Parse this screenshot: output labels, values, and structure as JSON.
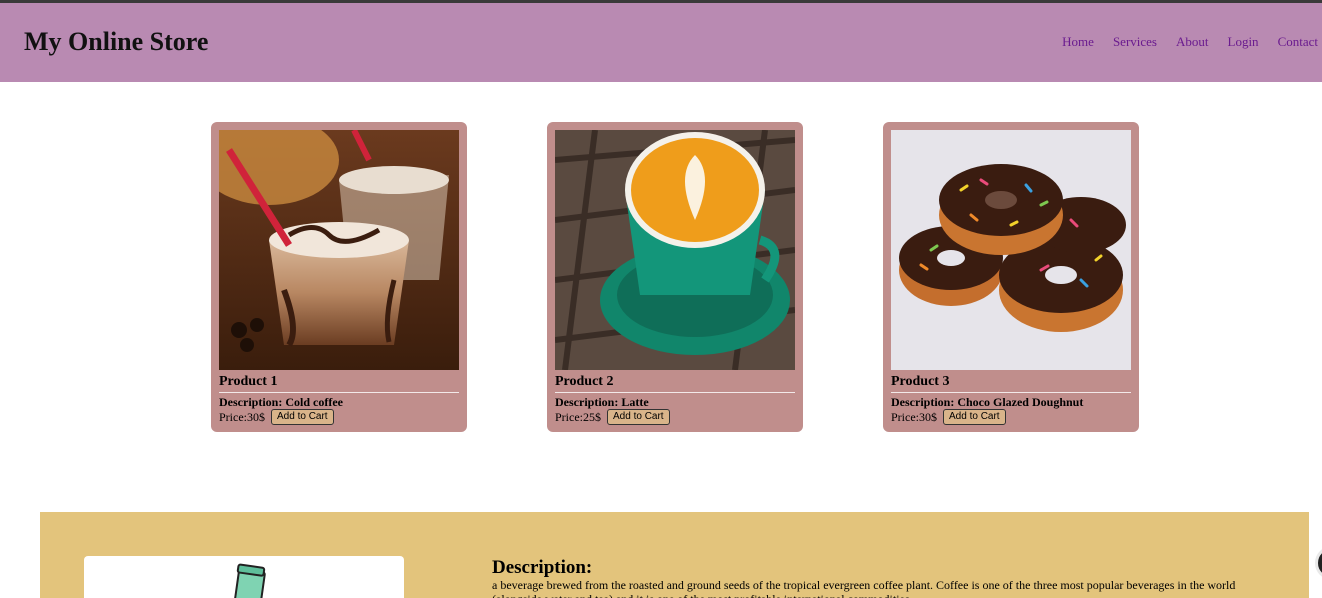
{
  "header": {
    "brand": "My Online Store",
    "nav": [
      "Home",
      "Services",
      "About",
      "Login",
      "Contact"
    ]
  },
  "products": [
    {
      "title": "Product 1",
      "description": "Description: Cold coffee",
      "price": "Price:30$",
      "button": "Add to Cart",
      "image": "cold-coffee-photo"
    },
    {
      "title": "Product 2",
      "description": "Description: Latte",
      "price": "Price:25$",
      "button": "Add to Cart",
      "image": "latte-photo"
    },
    {
      "title": "Product 3",
      "description": "Description: Choco Glazed Doughnut",
      "price": "Price:30$",
      "button": "Add to Cart",
      "image": "doughnut-photo"
    }
  ],
  "detail": {
    "heading": "Description:",
    "text": "a beverage brewed from the roasted and ground seeds of the tropical evergreen coffee plant. Coffee is one of the three most popular beverages in the world (alongside water and tea) and it is one of the most profitable international commodities.",
    "image": "iced-drink-illustration"
  },
  "colors": {
    "header_bg": "#b98ab2",
    "nav_link": "#6a1b8f",
    "card_bg": "#c08e8c",
    "cart_button": "#d9b48a",
    "detail_bg": "#e3c47c"
  }
}
